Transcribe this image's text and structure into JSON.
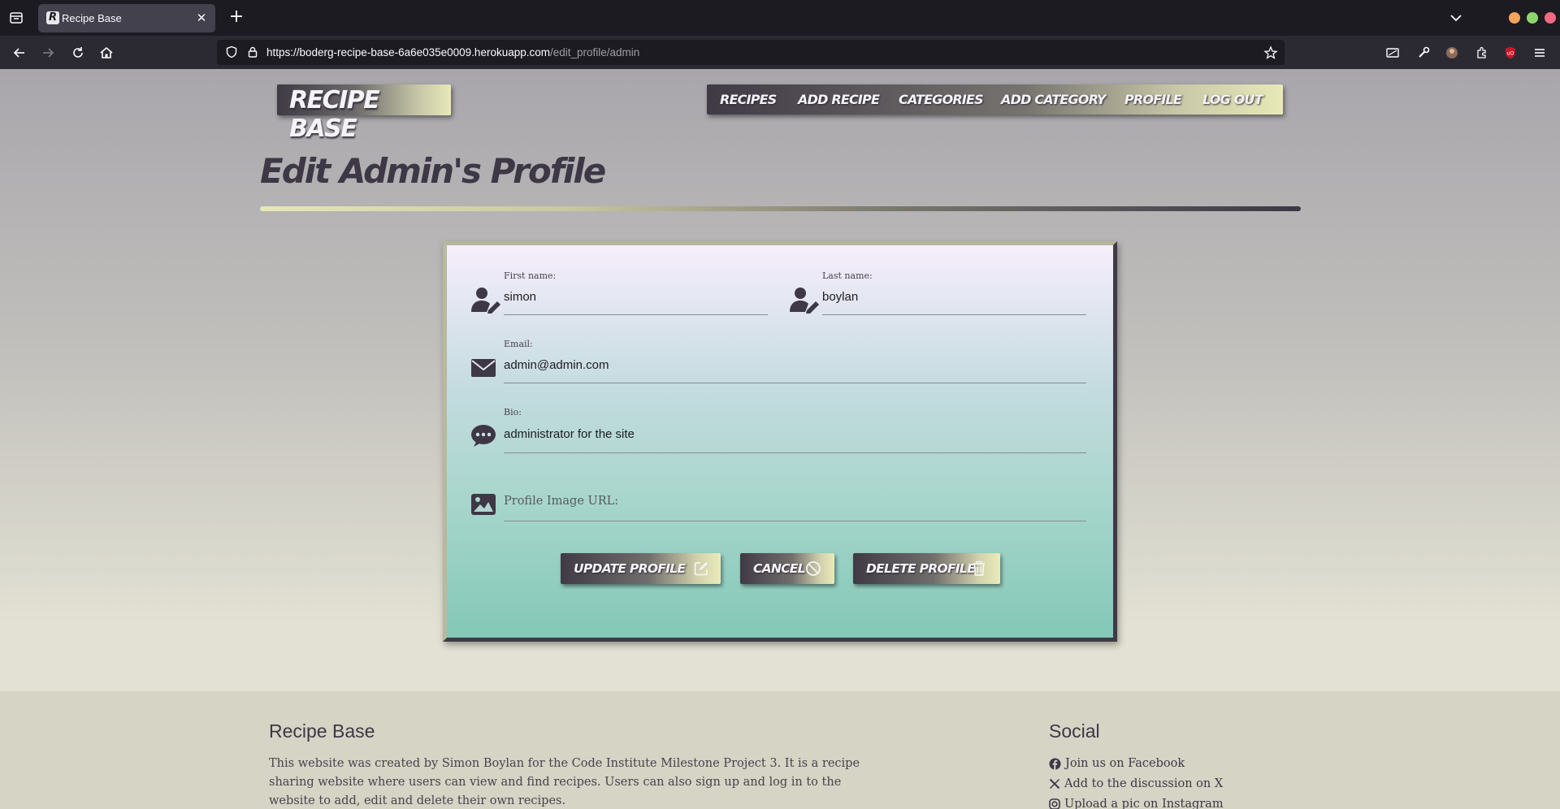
{
  "browser": {
    "tab_title": "Recipe Base",
    "tab_favicon_letter": "R",
    "url_main": "https://boderg-recipe-base-6a6e035e0009.herokuapp.com",
    "url_path": "/edit_profile/admin"
  },
  "site": {
    "logo": "RECIPE BASE",
    "nav": [
      "RECIPES",
      "ADD RECIPE",
      "CATEGORIES",
      "ADD CATEGORY",
      "PROFILE",
      "LOG OUT"
    ]
  },
  "page": {
    "title": "Edit Admin's Profile"
  },
  "form": {
    "first_name_label": "First name:",
    "first_name_value": "simon",
    "last_name_label": "Last name:",
    "last_name_value": "boylan",
    "email_label": "Email:",
    "email_value": "admin@admin.com",
    "bio_label": "Bio:",
    "bio_value": "administrator for the site",
    "image_placeholder": "Profile Image URL:",
    "update_label": "UPDATE PROFILE",
    "cancel_label": "CANCEL",
    "delete_label": "DELETE PROFILE"
  },
  "footer": {
    "about_title": "Recipe Base",
    "about_text": "This website was created by Simon Boylan for the Code Institute Milestone Project 3. It is a recipe sharing website where users can view and find recipes. Users can also sign up and log in to the website to add, edit and delete their own recipes.",
    "social_title": "Social",
    "social_links": [
      "Join us on Facebook",
      "Add to the discussion on X",
      "Upload a pic on Instagram"
    ]
  }
}
